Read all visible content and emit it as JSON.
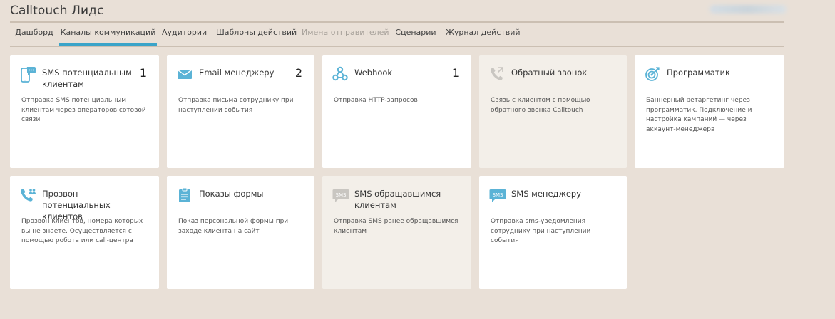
{
  "header": {
    "title": "Calltouch Лидс"
  },
  "tabs": [
    {
      "label": "Дашборд",
      "state": "normal"
    },
    {
      "label": "Каналы коммуникаций",
      "state": "active"
    },
    {
      "label": "Аудитории",
      "state": "normal"
    },
    {
      "label": "Шаблоны действий",
      "state": "normal"
    },
    {
      "label": "Имена отправителей",
      "state": "disabled"
    },
    {
      "label": "Сценарии",
      "state": "normal"
    },
    {
      "label": "Журнал действий",
      "state": "normal"
    }
  ],
  "cards": [
    {
      "title": "SMS потенциальным клиентам",
      "count": "1",
      "description": "Отправка SMS потенциальным клиентам через операторов сотовой связи",
      "icon": "sms-phone-icon",
      "enabled": true
    },
    {
      "title": "Email менеджеру",
      "count": "2",
      "description": "Отправка письма сотруднику при наступлении события",
      "icon": "envelope-icon",
      "enabled": true
    },
    {
      "title": "Webhook",
      "count": "1",
      "description": "Отправка HTTP-запросов",
      "icon": "webhook-icon",
      "enabled": true
    },
    {
      "title": "Обратный звонок",
      "count": "",
      "description": "Связь с клиентом с помощью обратного звонка Calltouch",
      "icon": "callback-phone-icon",
      "enabled": false
    },
    {
      "title": "Программатик",
      "count": "",
      "description": "Баннерный ретаргетинг через программатик. Подключение и настройка кампаний — через аккаунт-менеджера",
      "icon": "target-icon",
      "enabled": true
    },
    {
      "title": "Прозвон потенциальных клиентов",
      "count": "",
      "description": "Прозвон клиентов, номера которых вы не знаете. Осуществляется с помощью робота или call-центра",
      "icon": "phone-users-icon",
      "enabled": true
    },
    {
      "title": "Показы формы",
      "count": "",
      "description": "Показ персональной формы при заходе клиента на сайт",
      "icon": "clipboard-icon",
      "enabled": true
    },
    {
      "title": "SMS обращавшимся клиентам",
      "count": "",
      "description": "Отправка SMS ранее обращавшимся клиентам",
      "icon": "sms-bubble-icon",
      "enabled": false
    },
    {
      "title": "SMS менеджеру",
      "count": "",
      "description": "Отправка sms-уведомления сотруднику при наступлении события",
      "icon": "sms-bubble-icon",
      "enabled": true
    }
  ],
  "colors": {
    "background": "#e9e0d7",
    "accent": "#3aa4c9",
    "icon": "#5bb3d6",
    "icon_disabled": "#c9c6c1"
  }
}
